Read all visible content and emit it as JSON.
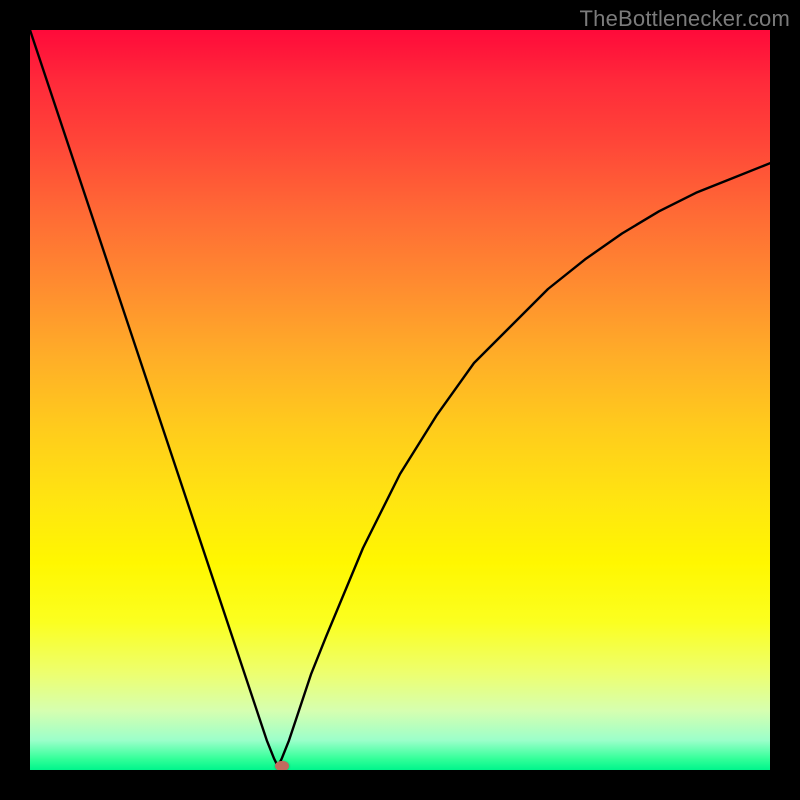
{
  "watermark": {
    "text": "TheBottlenecker.com"
  },
  "colors": {
    "frame": "#000000",
    "gradient_top": "#ff0a3a",
    "gradient_bottom": "#00f58c",
    "curve": "#000000",
    "marker": "#c26a5e"
  },
  "chart_data": {
    "type": "line",
    "title": "",
    "xlabel": "",
    "ylabel": "",
    "xlim": [
      0,
      100
    ],
    "ylim": [
      0,
      100
    ],
    "grid": false,
    "legend": false,
    "annotations": [
      "TheBottlenecker.com"
    ],
    "minimum_x": 33.5,
    "x": [
      0,
      5,
      10,
      15,
      20,
      25,
      30,
      31,
      32,
      33,
      33.5,
      34,
      35,
      36,
      38,
      40,
      45,
      50,
      55,
      60,
      65,
      70,
      75,
      80,
      85,
      90,
      95,
      100
    ],
    "y": [
      100,
      85,
      70,
      55,
      40,
      25,
      10,
      7,
      4,
      1.5,
      0.5,
      1.5,
      4,
      7,
      13,
      18,
      30,
      40,
      48,
      55,
      60,
      65,
      69,
      72.5,
      75.5,
      78,
      80,
      82
    ],
    "marker": {
      "x": 34,
      "y": 0.5
    }
  }
}
